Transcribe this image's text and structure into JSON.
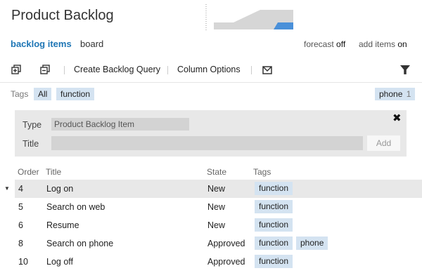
{
  "page_title": "Product Backlog",
  "nav": {
    "active": "backlog items",
    "other": "board"
  },
  "options": {
    "forecast_label": "forecast",
    "forecast_value": "off",
    "add_items_label": "add items",
    "add_items_value": "on"
  },
  "toolbar": {
    "create_query": "Create Backlog Query",
    "column_options": "Column Options"
  },
  "tag_filter": {
    "label": "Tags",
    "all": "All",
    "function": "function",
    "phone": "phone",
    "phone_count": "1"
  },
  "add_panel": {
    "type_label": "Type",
    "type_value": "Product Backlog Item",
    "title_label": "Title",
    "add_button": "Add"
  },
  "columns": {
    "order": "Order",
    "title": "Title",
    "state": "State",
    "tags": "Tags"
  },
  "rows": [
    {
      "order": "4",
      "title": "Log on",
      "state": "New",
      "tags": [
        "function"
      ]
    },
    {
      "order": "5",
      "title": "Search on web",
      "state": "New",
      "tags": [
        "function"
      ]
    },
    {
      "order": "6",
      "title": "Resume",
      "state": "New",
      "tags": [
        "function"
      ]
    },
    {
      "order": "8",
      "title": "Search on phone",
      "state": "Approved",
      "tags": [
        "function",
        "phone"
      ]
    },
    {
      "order": "10",
      "title": "Log off",
      "state": "Approved",
      "tags": [
        "function"
      ]
    }
  ],
  "colors": {
    "accent": "#1e76b5",
    "chip": "#d4e3f1",
    "burndown_fill": "#d6d6d6",
    "burndown_blue": "#4a90d9"
  }
}
